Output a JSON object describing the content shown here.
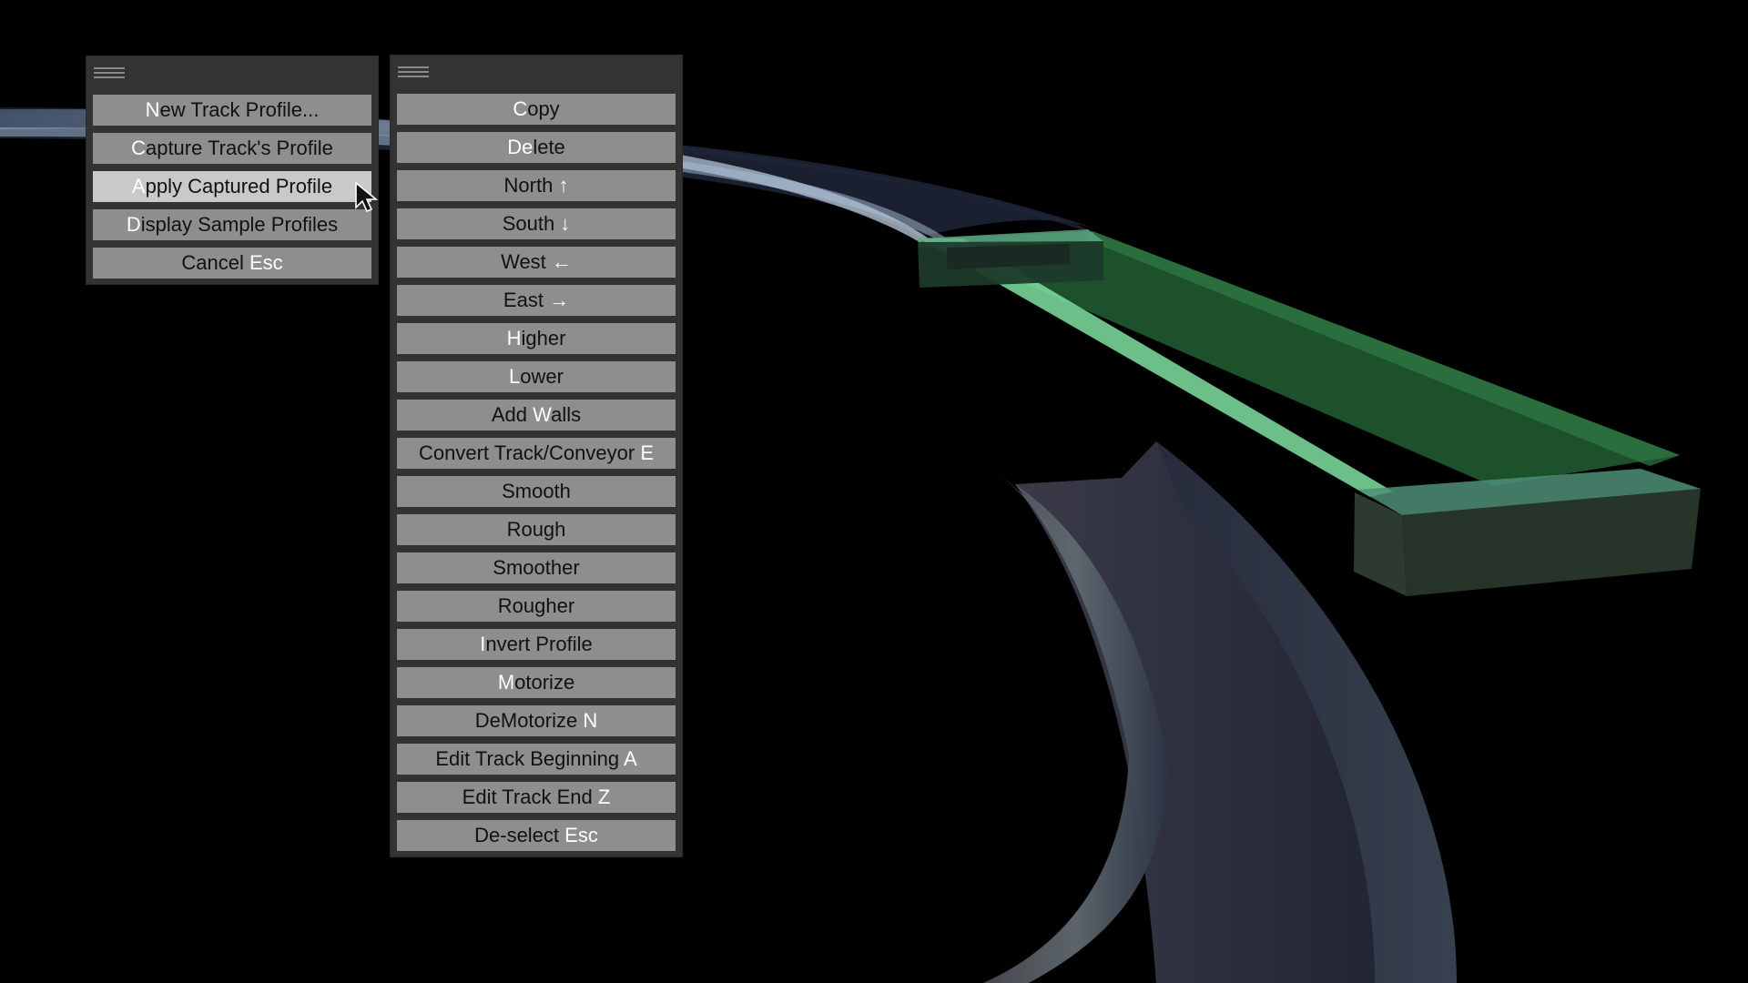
{
  "left_menu": {
    "items": [
      {
        "segments": [
          {
            "t": "N",
            "hk": true
          },
          {
            "t": "ew Track Profile...",
            "hk": false
          }
        ],
        "hover": false
      },
      {
        "segments": [
          {
            "t": "C",
            "hk": true
          },
          {
            "t": "apture Track's Profile",
            "hk": false
          }
        ],
        "hover": false
      },
      {
        "segments": [
          {
            "t": "A",
            "hk": true
          },
          {
            "t": "pply Captured Profile",
            "hk": false
          }
        ],
        "hover": true
      },
      {
        "segments": [
          {
            "t": "D",
            "hk": true
          },
          {
            "t": "isplay Sample Profiles",
            "hk": false
          }
        ],
        "hover": false
      },
      {
        "segments": [
          {
            "t": "Cancel ",
            "hk": false
          },
          {
            "t": "Esc",
            "hk": true
          }
        ],
        "hover": false
      }
    ]
  },
  "right_menu": {
    "items": [
      {
        "segments": [
          {
            "t": "C",
            "hk": true
          },
          {
            "t": "opy",
            "hk": false
          }
        ]
      },
      {
        "segments": [
          {
            "t": "De",
            "hk": true
          },
          {
            "t": "l",
            "hk": false
          },
          {
            "t": "ete",
            "hk": false
          }
        ]
      },
      {
        "segments": [
          {
            "t": "North ",
            "hk": false
          },
          {
            "t": "↑",
            "hk": true
          }
        ]
      },
      {
        "segments": [
          {
            "t": "South ",
            "hk": false
          },
          {
            "t": "↓",
            "hk": true
          }
        ]
      },
      {
        "segments": [
          {
            "t": "West ",
            "hk": false
          },
          {
            "t": "←",
            "hk": true
          }
        ]
      },
      {
        "segments": [
          {
            "t": "East ",
            "hk": false
          },
          {
            "t": "→",
            "hk": true
          }
        ]
      },
      {
        "segments": [
          {
            "t": "H",
            "hk": true
          },
          {
            "t": "igher",
            "hk": false
          }
        ]
      },
      {
        "segments": [
          {
            "t": "L",
            "hk": true
          },
          {
            "t": "ower",
            "hk": false
          }
        ]
      },
      {
        "segments": [
          {
            "t": "Add ",
            "hk": false
          },
          {
            "t": "W",
            "hk": true
          },
          {
            "t": "alls",
            "hk": false
          }
        ]
      },
      {
        "segments": [
          {
            "t": "Convert Track/Conveyor ",
            "hk": false
          },
          {
            "t": "E",
            "hk": true
          }
        ]
      },
      {
        "segments": [
          {
            "t": "Smooth",
            "hk": false
          }
        ]
      },
      {
        "segments": [
          {
            "t": "Rough",
            "hk": false
          }
        ]
      },
      {
        "segments": [
          {
            "t": "Smoother",
            "hk": false
          }
        ]
      },
      {
        "segments": [
          {
            "t": "Rougher",
            "hk": false
          }
        ]
      },
      {
        "segments": [
          {
            "t": "I",
            "hk": true
          },
          {
            "t": "nvert Profile",
            "hk": false
          }
        ]
      },
      {
        "segments": [
          {
            "t": "M",
            "hk": true
          },
          {
            "t": "otorize",
            "hk": false
          }
        ]
      },
      {
        "segments": [
          {
            "t": "DeMotorize ",
            "hk": false
          },
          {
            "t": "N",
            "hk": true
          }
        ]
      },
      {
        "segments": [
          {
            "t": "Edit Track Beginning ",
            "hk": false
          },
          {
            "t": "A",
            "hk": true
          }
        ]
      },
      {
        "segments": [
          {
            "t": "Edit Track End ",
            "hk": false
          },
          {
            "t": "Z",
            "hk": true
          }
        ]
      },
      {
        "segments": [
          {
            "t": "De-select ",
            "hk": false
          },
          {
            "t": "Esc",
            "hk": true
          }
        ]
      }
    ]
  },
  "colors": {
    "panel_bg": "#333333",
    "button_bg": "#8e8e8e",
    "button_hover_bg": "#c9c9c9",
    "button_text": "#111111",
    "hotkey_text": "#ffffff",
    "track_green": "#2f7a45",
    "track_light_green": "#7fe0a0",
    "track_blue_grey": "#2a3346",
    "track_pale_blue": "#a9c0d8"
  },
  "icons": {
    "handle": "drag-handle-icon",
    "cursor": "mouse-pointer-icon"
  }
}
